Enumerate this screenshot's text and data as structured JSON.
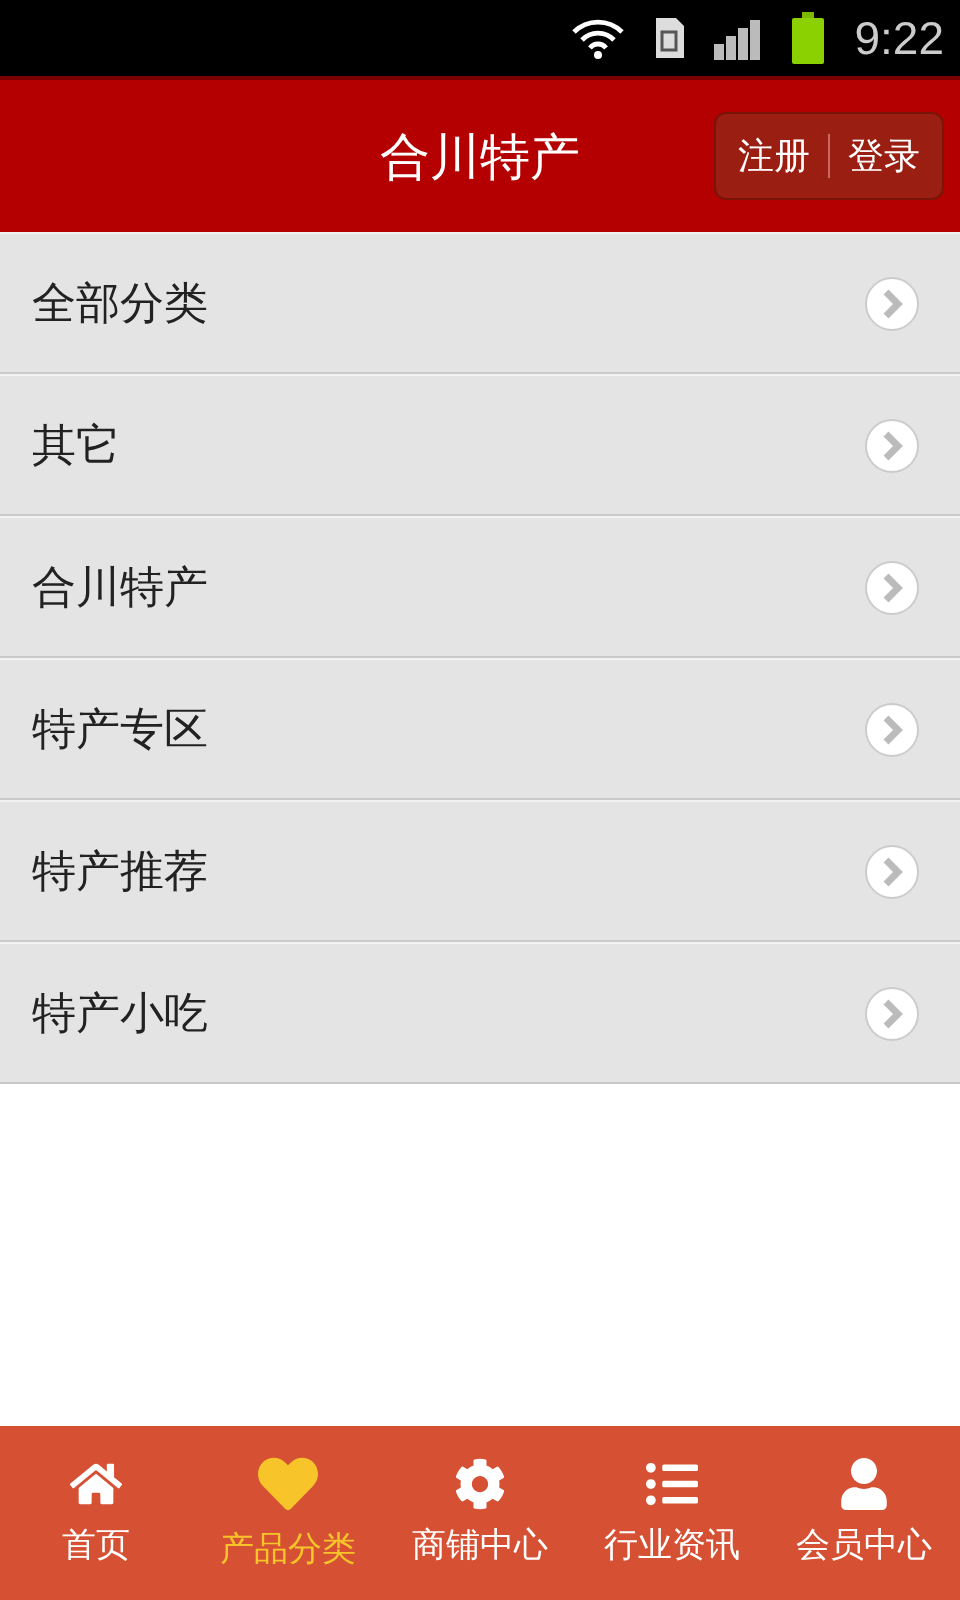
{
  "status_bar": {
    "time": "9:22"
  },
  "header": {
    "title": "合川特产",
    "register": "注册",
    "login": "登录"
  },
  "categories": [
    {
      "label": "全部分类"
    },
    {
      "label": "其它"
    },
    {
      "label": "合川特产"
    },
    {
      "label": "特产专区"
    },
    {
      "label": "特产推荐"
    },
    {
      "label": "特产小吃"
    }
  ],
  "tab_bar": [
    {
      "kind": "home",
      "label": "首页",
      "selected": false
    },
    {
      "kind": "heart",
      "label": "产品分类",
      "selected": true
    },
    {
      "kind": "gear",
      "label": "商铺中心",
      "selected": false
    },
    {
      "kind": "list",
      "label": "行业资讯",
      "selected": false
    },
    {
      "kind": "user",
      "label": "会员中心",
      "selected": false
    }
  ]
}
